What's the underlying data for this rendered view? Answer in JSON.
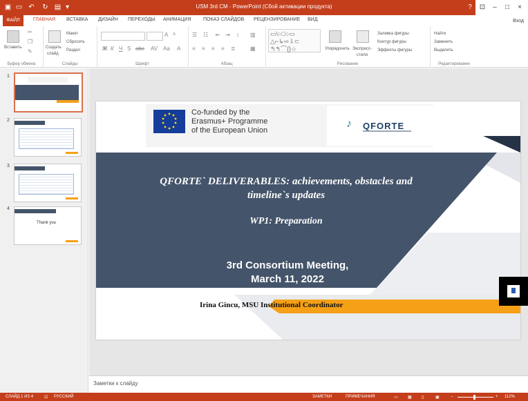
{
  "window": {
    "title": "USM 3rd CM - PowerPoint (Сбой активации продукта)",
    "help": "?"
  },
  "tabs": [
    "ФАЙЛ",
    "ГЛАВНАЯ",
    "ВСТАВКА",
    "ДИЗАЙН",
    "ПЕРЕХОДЫ",
    "АНИМАЦИЯ",
    "ПОКАЗ СЛАЙДОВ",
    "РЕЦЕНЗИРОВАНИЕ",
    "ВИД"
  ],
  "login": "Вход",
  "ribbon": {
    "paste": "Вставить",
    "clipboard": "Буфер обмена",
    "create_slide": "Создать",
    "create_slide2": "слайд",
    "layout": "Макет",
    "reset": "Сбросить",
    "section": "Раздел",
    "slides": "Слайды",
    "font": "Шрифт",
    "paragraph": "Абзац",
    "arrange": "Упорядочить",
    "express": "Экспресс-",
    "styles": "стили",
    "drawing": "Рисование",
    "fill": "Заливка фигуры",
    "outline": "Контур фигуры",
    "effects": "Эффекты фигуры",
    "find": "Найти",
    "replace": "Заменить",
    "select": "Выделить",
    "editing": "Редактирование"
  },
  "thumbs": [
    {
      "num": "1",
      "text": ""
    },
    {
      "num": "2",
      "text": ""
    },
    {
      "num": "3",
      "text": ""
    },
    {
      "num": "4",
      "text": "Thank you"
    }
  ],
  "slide": {
    "eu_line1": "Co-funded by the",
    "eu_line2": "Erasmus+ Programme",
    "eu_line3": "of the European Union",
    "qforte": "QFORTE",
    "title_line1": "QFORTE` DELIVERABLES: achievements, obstacles and",
    "title_line2": "timeline`s updates",
    "subtitle": "WP1: Preparation",
    "meeting_line1": "3rd Consortium Meeting,",
    "meeting_line2": "March 11, 2022",
    "presenter": "Irina Gincu, MSU Institutional Coordinator"
  },
  "notes": "Заметки к слайду",
  "status": {
    "slide": "СЛАЙД 1 ИЗ 4",
    "lang": "РУССКИЙ",
    "notes": "ЗАМЕТКИ",
    "comments": "ПРИМЕЧАНИЯ",
    "zoom": "112%"
  },
  "colors": {
    "accent": "#c43e1c",
    "navy": "#44546a",
    "orange": "#f5a017"
  }
}
